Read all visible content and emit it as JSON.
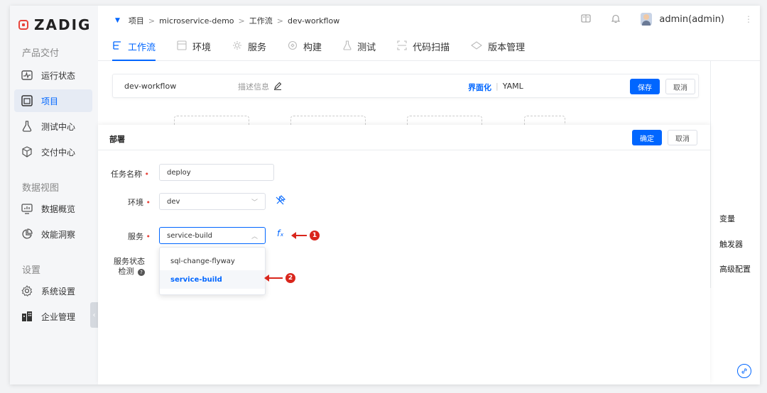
{
  "brand": {
    "name": "ZADIG"
  },
  "sidebar": {
    "sections": [
      {
        "label": "产品交付"
      },
      {
        "label": "数据视图"
      },
      {
        "label": "设置"
      }
    ],
    "items": [
      {
        "label": "运行状态",
        "icon": "pulse-icon"
      },
      {
        "label": "项目",
        "icon": "project-icon",
        "active": true
      },
      {
        "label": "测试中心",
        "icon": "flask-icon"
      },
      {
        "label": "交付中心",
        "icon": "package-icon"
      },
      {
        "label": "数据概览",
        "icon": "chart-icon"
      },
      {
        "label": "效能洞察",
        "icon": "pie-icon"
      },
      {
        "label": "系统设置",
        "icon": "gear-icon"
      },
      {
        "label": "企业管理",
        "icon": "building-icon"
      }
    ],
    "collapse_glyph": "‹"
  },
  "breadcrumb": {
    "items": [
      "项目",
      "microservice-demo",
      "工作流",
      "dev-workflow"
    ],
    "separator": ">"
  },
  "topbar": {
    "user": "admin(admin)"
  },
  "tabs": [
    {
      "label": "工作流",
      "active": true
    },
    {
      "label": "环境"
    },
    {
      "label": "服务"
    },
    {
      "label": "构建"
    },
    {
      "label": "测试"
    },
    {
      "label": "代码扫描"
    },
    {
      "label": "版本管理"
    }
  ],
  "workflow": {
    "name": "dev-workflow",
    "description_placeholder": "描述信息",
    "mode_ui": "界面化",
    "mode_divider": "|",
    "mode_yaml": "YAML",
    "save_label": "保存",
    "cancel_label": "取消"
  },
  "right_links": [
    "变量",
    "触发器",
    "高级配置"
  ],
  "panel": {
    "title": "部署",
    "confirm_label": "确定",
    "cancel_label": "取消",
    "fields": {
      "task_name": {
        "label": "任务名称",
        "value": "deploy"
      },
      "env": {
        "label": "环境",
        "value": "dev"
      },
      "service": {
        "label": "服务",
        "value": "service-build"
      },
      "status_check": {
        "label_line1": "服务状态",
        "label_line2": "检测"
      }
    },
    "required_mark": "•",
    "fx_label": "fₓ",
    "dropdown_options": [
      {
        "label": "sql-change-flyway"
      },
      {
        "label": "service-build",
        "selected": true
      }
    ]
  },
  "callouts": [
    "1",
    "2"
  ],
  "colors": {
    "accent": "#0066ff",
    "danger": "#d9261c",
    "brand": "#e8453c"
  }
}
